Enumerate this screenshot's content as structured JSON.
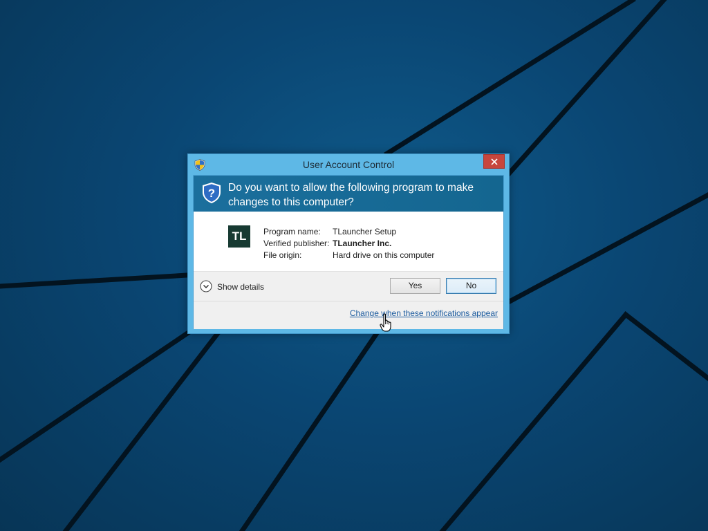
{
  "window": {
    "title": "User Account Control",
    "close_label": "×"
  },
  "prompt": {
    "question": "Do you want to allow the following program to make changes to this computer?"
  },
  "program": {
    "icon_text": "TL",
    "icon_color": "#173a32",
    "fields": [
      {
        "label": "Program name:",
        "value": "TLauncher Setup"
      },
      {
        "label": "Verified publisher:",
        "value": "TLauncher Inc."
      },
      {
        "label": "File origin:",
        "value": "Hard drive on this computer"
      }
    ]
  },
  "footer": {
    "details_label": "Show details",
    "yes_label": "Yes",
    "no_label": "No",
    "settings_link": "Change when these notifications appear"
  },
  "colors": {
    "frame": "#5eb8e6",
    "question_band": "#1b6f9d",
    "close_button": "#c7463d",
    "link": "#1a5a9e",
    "desktop": "#0a4673"
  },
  "icons": {
    "title": "uac-shield-icon",
    "question": "help-shield-icon",
    "details": "chevron-down-circle-icon",
    "cursor": "hand-pointer-icon"
  }
}
